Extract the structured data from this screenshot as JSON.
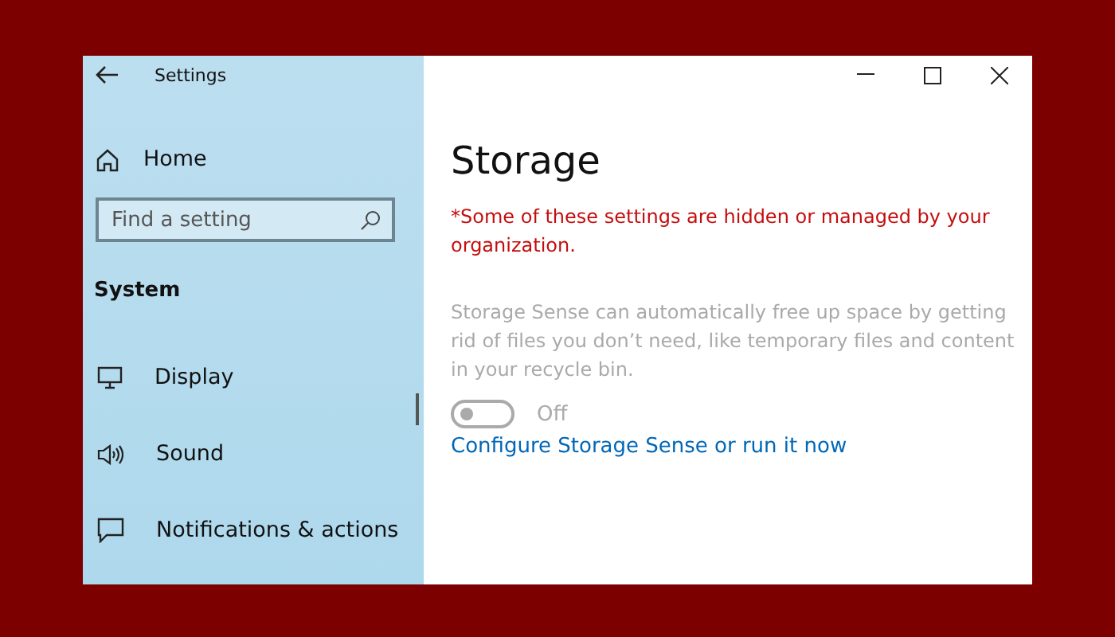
{
  "window": {
    "title": "Settings"
  },
  "sidebar": {
    "home": "Home",
    "search": {
      "placeholder": "Find a setting"
    },
    "section": "System",
    "items": [
      {
        "label": "Display",
        "kind": "monitor",
        "selected": false
      },
      {
        "label": "Sound",
        "kind": "speaker",
        "selected": false
      },
      {
        "label": "Notifications & actions",
        "kind": "message",
        "selected": false
      }
    ]
  },
  "page": {
    "title": "Storage",
    "notice": "*Some of these settings are hidden or managed by your organization.",
    "description": "Storage Sense can automatically free up space by getting rid of files you don’t need, like temporary files and content in your recycle bin.",
    "toggle": {
      "on": false,
      "disabled": true,
      "label": "Off"
    },
    "link": "Configure Storage Sense or run it now"
  }
}
